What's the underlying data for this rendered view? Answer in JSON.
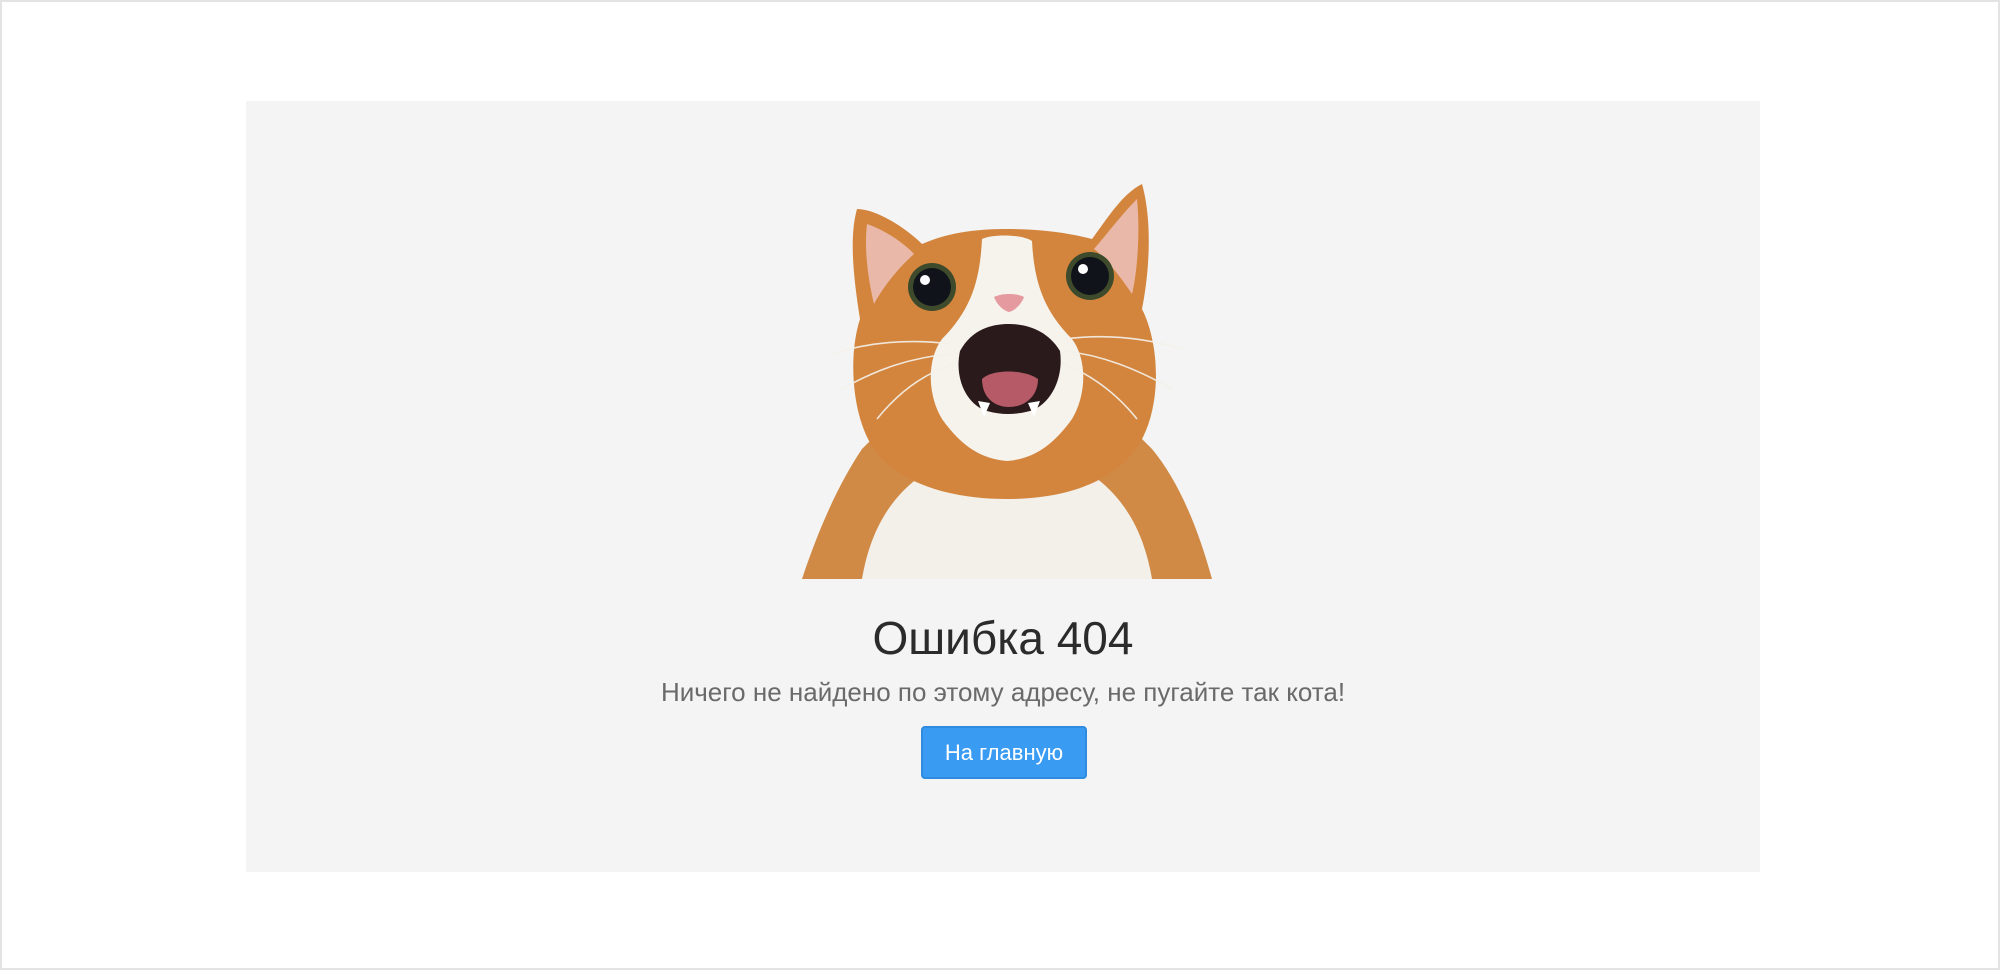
{
  "error_page": {
    "title": "Ошибка 404",
    "message": "Ничего не найдено по этому адресу, не пугайте так кота!",
    "home_button_label": "На главную"
  },
  "colors": {
    "page_background": "#ffffff",
    "panel_background": "#f4f4f4",
    "button_background": "#3a9bf3",
    "button_text": "#ffffff",
    "title_text": "#2b2b2b",
    "message_text": "#6a6a6a"
  },
  "illustration": {
    "icon": "surprised-cat-photo"
  }
}
